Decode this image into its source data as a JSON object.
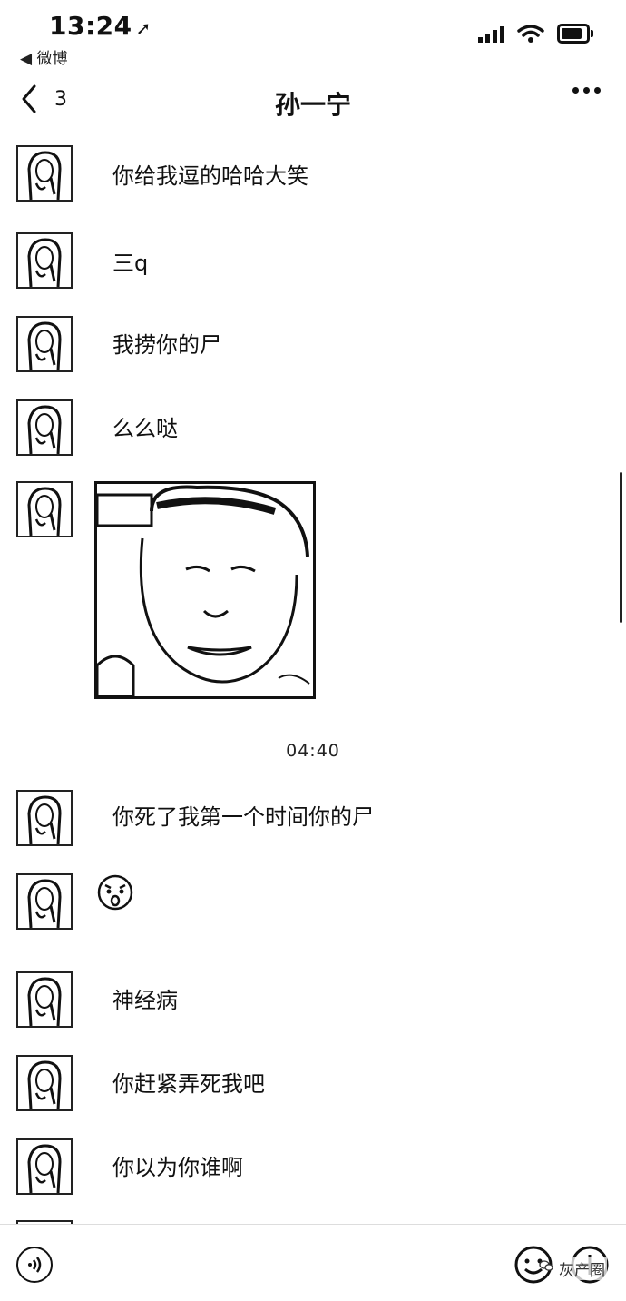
{
  "status": {
    "time": "13:24",
    "location_glyph": "➚",
    "back_app": "◀ 微博"
  },
  "nav": {
    "unread_count": "3",
    "title": "孙一宁"
  },
  "messages": [
    {
      "type": "text",
      "text": "你给我逗的哈哈大笑"
    },
    {
      "type": "text",
      "text": "三q"
    },
    {
      "type": "text",
      "text": "我捞你的尸"
    },
    {
      "type": "text",
      "text": "么么哒"
    },
    {
      "type": "video"
    },
    {
      "type": "text",
      "text": "你死了我第一个时间你的尸"
    },
    {
      "type": "sticker",
      "icon": "surprised-face-icon"
    },
    {
      "type": "text",
      "text": "神经病"
    },
    {
      "type": "text",
      "text": "你赶紧弄死我吧"
    },
    {
      "type": "text",
      "text": "你以为你谁啊"
    }
  ],
  "timestamp": "04:40",
  "input_bar": {
    "watermark": "灰产圈"
  },
  "colors": {
    "foreground": "#111111",
    "background": "#ffffff"
  }
}
